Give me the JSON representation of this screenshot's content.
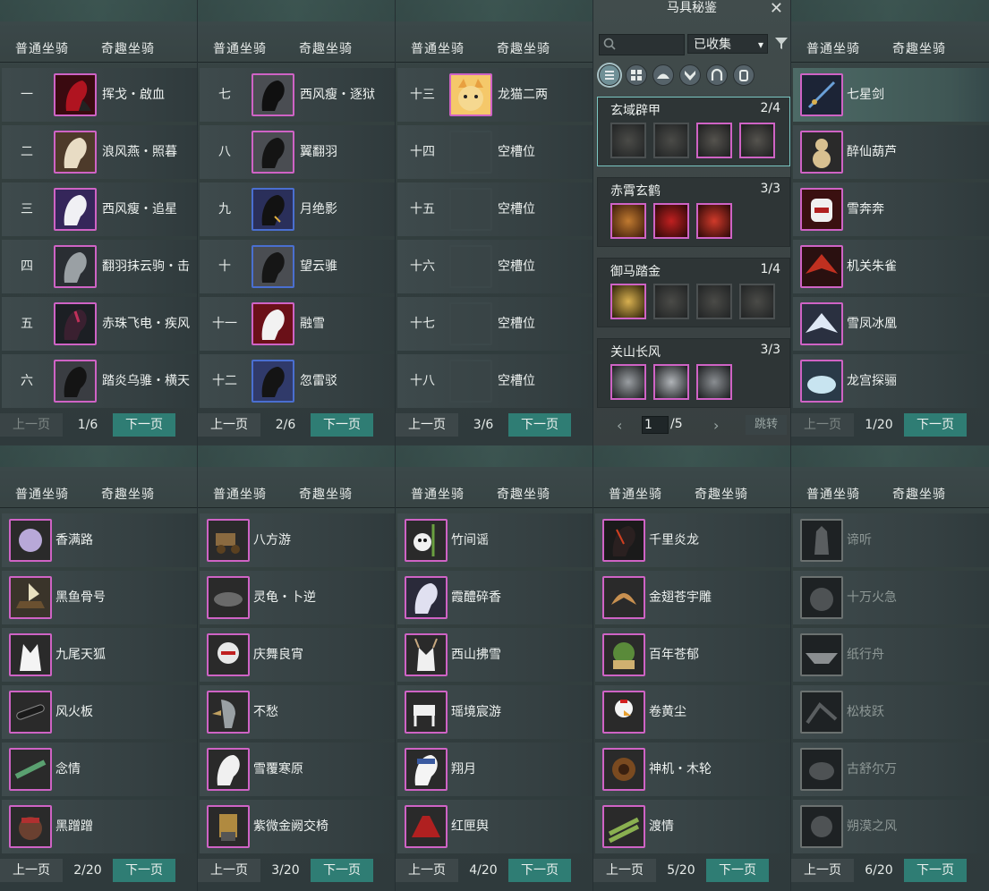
{
  "tabs": {
    "normal": "普通坐骑",
    "special": "奇趣坐骑"
  },
  "buttons": {
    "prev": "上一页",
    "next": "下一页"
  },
  "panels": [
    {
      "page": "1/6",
      "prev_disabled": true,
      "rows": [
        {
          "num": "一",
          "name": "挥戈・啟血"
        },
        {
          "num": "二",
          "name": "浪风燕・照暮"
        },
        {
          "num": "三",
          "name": "西风瘦・追星"
        },
        {
          "num": "四",
          "name": "翻羽抹云驹・击"
        },
        {
          "num": "五",
          "name": "赤珠飞电・疾风"
        },
        {
          "num": "六",
          "name": "踏炎乌骓・横天"
        }
      ]
    },
    {
      "page": "2/6",
      "rows": [
        {
          "num": "七",
          "name": "西风瘦・逐狱"
        },
        {
          "num": "八",
          "name": "翼翻羽"
        },
        {
          "num": "九",
          "name": "月绝影"
        },
        {
          "num": "十",
          "name": "望云骓"
        },
        {
          "num": "十一",
          "name": "融雪"
        },
        {
          "num": "十二",
          "name": "忽雷驳"
        }
      ]
    },
    {
      "page": "3/6",
      "rows": [
        {
          "num": "十三",
          "name": "龙猫二两"
        },
        {
          "num": "十四",
          "name": "空槽位"
        },
        {
          "num": "十五",
          "name": "空槽位"
        },
        {
          "num": "十六",
          "name": "空槽位"
        },
        {
          "num": "十七",
          "name": "空槽位"
        },
        {
          "num": "十八",
          "name": "空槽位"
        }
      ]
    },
    {
      "page": "1/20",
      "prev_disabled": true,
      "rows": [
        {
          "name": "七星剑"
        },
        {
          "name": "醉仙葫芦"
        },
        {
          "name": "雪奔奔"
        },
        {
          "name": "机关朱雀"
        },
        {
          "name": "雪凤冰凰"
        },
        {
          "name": "龙宫探骊"
        }
      ]
    },
    {
      "page": "2/20",
      "rows": [
        {
          "name": "香满路"
        },
        {
          "name": "黑鱼骨号"
        },
        {
          "name": "九尾天狐"
        },
        {
          "name": "风火板"
        },
        {
          "name": "念情"
        },
        {
          "name": "黑蹭蹭"
        }
      ]
    },
    {
      "page": "3/20",
      "rows": [
        {
          "name": "八方游"
        },
        {
          "name": "灵龟・卜逆"
        },
        {
          "name": "庆舞良宵"
        },
        {
          "name": "不愁"
        },
        {
          "name": "雪覆寒原"
        },
        {
          "name": "紫微金阙交椅"
        }
      ]
    },
    {
      "page": "4/20",
      "rows": [
        {
          "name": "竹间谣"
        },
        {
          "name": "霞醴碎香"
        },
        {
          "name": "西山拂雪"
        },
        {
          "name": "瑶境宸游"
        },
        {
          "name": "翔月"
        },
        {
          "name": "红匣舆"
        }
      ]
    },
    {
      "page": "5/20",
      "rows": [
        {
          "name": "千里炎龙"
        },
        {
          "name": "金翅苍宇雕"
        },
        {
          "name": "百年苍郁"
        },
        {
          "name": "卷黄尘"
        },
        {
          "name": "神机・木轮"
        },
        {
          "name": "渡情"
        }
      ]
    },
    {
      "page": "6/20",
      "rows": [
        {
          "name": "谛听"
        },
        {
          "name": "十万火急"
        },
        {
          "name": "纸行舟"
        },
        {
          "name": "松枝跃"
        },
        {
          "name": "古舒尔万"
        },
        {
          "name": "朔漠之风"
        }
      ]
    }
  ],
  "collection": {
    "title": "马具秘鉴",
    "filter": "已收集",
    "sets": [
      {
        "name": "玄域辟甲",
        "count": "2/4"
      },
      {
        "name": "赤霄玄鹤",
        "count": "3/3"
      },
      {
        "name": "御马踏金",
        "count": "1/4"
      },
      {
        "name": "关山长风",
        "count": "3/3"
      }
    ],
    "page_value": "1",
    "page_total": "/5",
    "jump": "跳转"
  },
  "icons": [
    "search-icon",
    "funnel-icon",
    "close-icon",
    "list-view-icon",
    "grid-view-icon",
    "saddle-icon",
    "armor-icon",
    "horseshoe-icon",
    "stirrup-icon",
    "arrow-left-icon",
    "arrow-right-icon"
  ],
  "colors": {
    "accent_teal": "#2f7d74",
    "frame_purple": "#cf63c5",
    "frame_blue": "#4a6fd0",
    "active_cyan": "#7ac6c1"
  }
}
